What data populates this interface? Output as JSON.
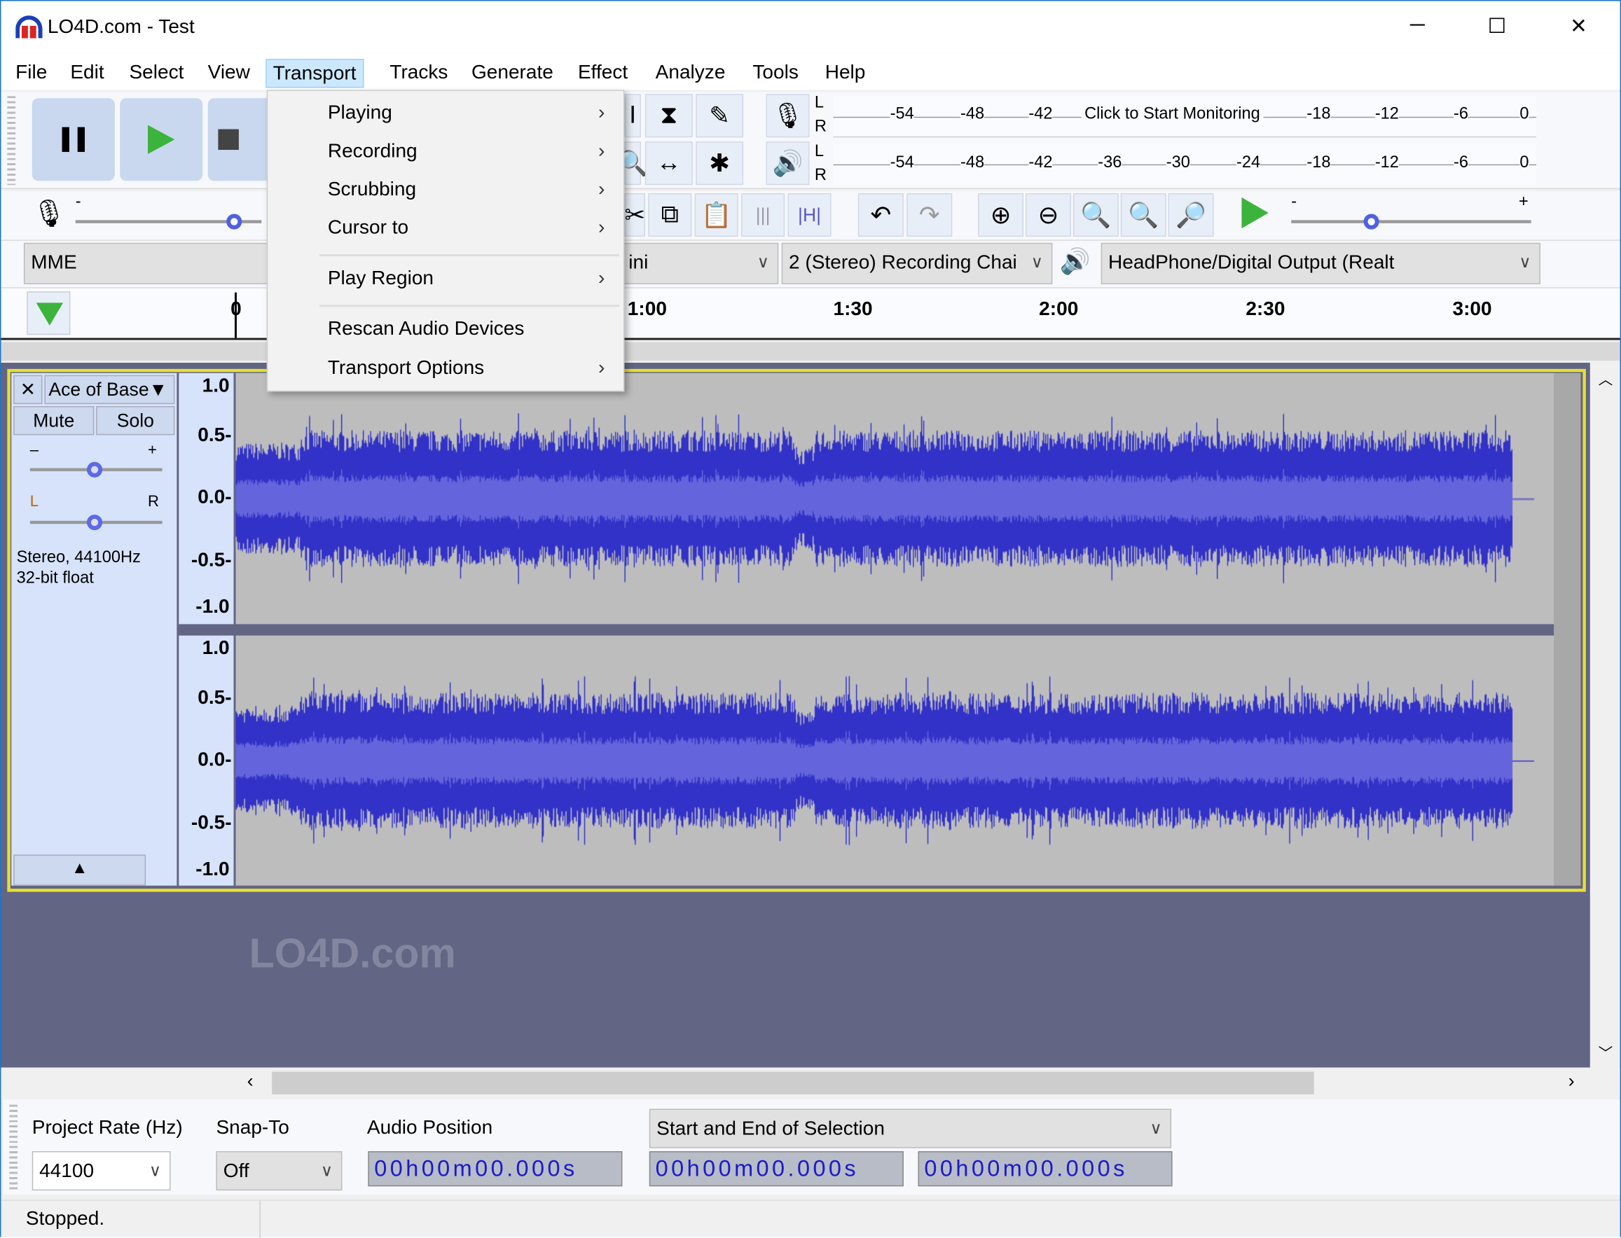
{
  "window": {
    "title": "LO4D.com - Test",
    "minimize": "─",
    "maximize": "☐",
    "close": "✕"
  },
  "menu": [
    "File",
    "Edit",
    "Select",
    "View",
    "Transport",
    "Tracks",
    "Generate",
    "Effect",
    "Analyze",
    "Tools",
    "Help"
  ],
  "transport_menu": {
    "items": [
      {
        "label": "Playing",
        "submenu": true
      },
      {
        "label": "Recording",
        "submenu": true
      },
      {
        "label": "Scrubbing",
        "submenu": true
      },
      {
        "label": "Cursor to",
        "submenu": true
      },
      {
        "label": "Play Region",
        "submenu": true
      },
      {
        "label": "Rescan Audio Devices",
        "submenu": false
      },
      {
        "label": "Transport Options",
        "submenu": true
      }
    ],
    "arrow": "›"
  },
  "meters": {
    "record_ticks": [
      "-54",
      "-48",
      "-42",
      "-18",
      "-12",
      "-6",
      "0"
    ],
    "record_prompt": "Click to Start Monitoring",
    "play_ticks": [
      "-54",
      "-48",
      "-42",
      "-36",
      "-30",
      "-24",
      "-18",
      "-12",
      "-6",
      "0"
    ],
    "L": "L",
    "R": "R"
  },
  "sliders": {
    "minus": "-",
    "plus": "+"
  },
  "devices": {
    "host": "MME",
    "record_device": "ini",
    "channels": "2 (Stereo) Recording Chai",
    "output": "HeadPhone/Digital Output (Realt"
  },
  "timeline": {
    "labels": [
      "0",
      "1:00",
      "1:30",
      "2:00",
      "2:30",
      "3:00"
    ]
  },
  "track": {
    "name": "Ace of Base",
    "mute": "Mute",
    "solo": "Solo",
    "gain_minus": "–",
    "gain_plus": "+",
    "pan_l": "L",
    "pan_r": "R",
    "info1": "Stereo, 44100Hz",
    "info2": "32-bit float",
    "scale": [
      "1.0",
      "0.5-",
      "0.0-",
      "-0.5-",
      "-1.0"
    ],
    "waveform_color": "#3232c8",
    "waveform_rms_color": "#6464dc"
  },
  "watermark": "LO4D.com",
  "bottom": {
    "project_rate_label": "Project Rate (Hz)",
    "project_rate": "44100",
    "snap_label": "Snap-To",
    "snap": "Off",
    "audio_pos_label": "Audio Position",
    "selection_mode": "Start and End of Selection",
    "audio_pos": "00h00m00.000s",
    "sel_start": "00h00m00.000s",
    "sel_end": "00h00m00.000s"
  },
  "status": "Stopped."
}
